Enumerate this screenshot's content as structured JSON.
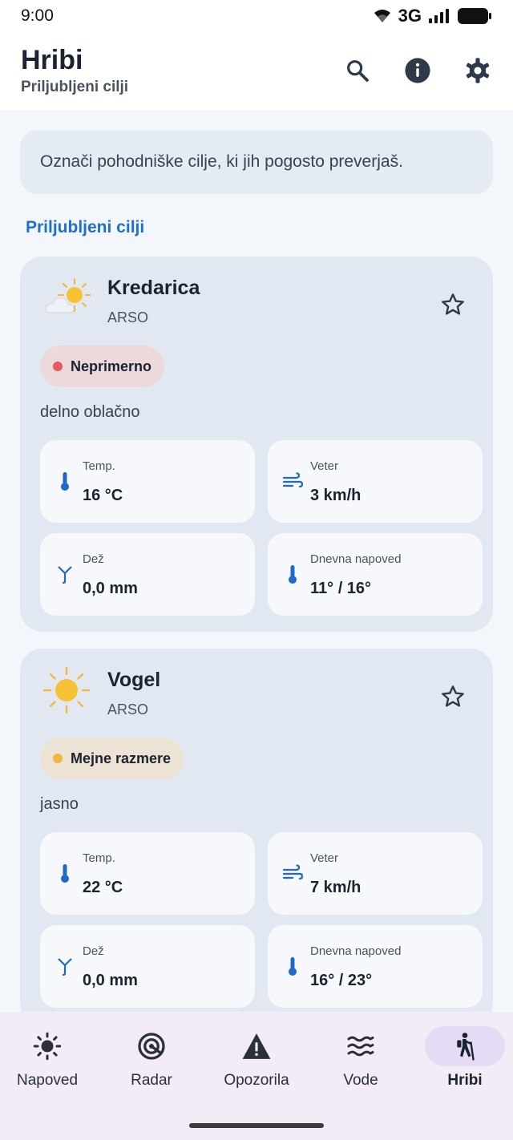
{
  "status_bar": {
    "time": "9:00",
    "network": "3G"
  },
  "header": {
    "title": "Hribi",
    "subtitle": "Priljubljeni cilji",
    "icons": [
      "search-icon",
      "info-icon",
      "gear-icon"
    ]
  },
  "info_banner": "Označi pohodniške cilje, ki jih pogosto preverjaš.",
  "section_title": "Priljubljeni cilji",
  "colors": {
    "accent": "#1f6fd0",
    "danger_dot": "#e85a5a",
    "warning_dot": "#f2b63c",
    "nav_active_bg": "#e5dbf5"
  },
  "cards": [
    {
      "name": "Kredarica",
      "source": "ARSO",
      "weather_icon": "partly-cloudy-icon",
      "status": "Neprimerno",
      "condition": "delno oblačno",
      "tiles": [
        {
          "label": "Temp.",
          "value": "16 °C",
          "icon": "thermometer-icon"
        },
        {
          "label": "Veter",
          "value": "3 km/h",
          "icon": "wind-icon"
        },
        {
          "label": "Dež",
          "value": "0,0 mm",
          "icon": "umbrella-icon"
        },
        {
          "label": "Dnevna napoved",
          "value": "11° / 16°",
          "icon": "thermometer-icon"
        }
      ]
    },
    {
      "name": "Vogel",
      "source": "ARSO",
      "weather_icon": "sun-icon",
      "status": "Mejne razmere",
      "condition": "jasno",
      "tiles": [
        {
          "label": "Temp.",
          "value": "22 °C",
          "icon": "thermometer-icon"
        },
        {
          "label": "Veter",
          "value": "7 km/h",
          "icon": "wind-icon"
        },
        {
          "label": "Dež",
          "value": "0,0 mm",
          "icon": "umbrella-icon"
        },
        {
          "label": "Dnevna napoved",
          "value": "16° / 23°",
          "icon": "thermometer-icon"
        }
      ]
    }
  ],
  "nav": [
    {
      "label": "Napoved",
      "icon": "sun-icon"
    },
    {
      "label": "Radar",
      "icon": "radar-icon"
    },
    {
      "label": "Opozorila",
      "icon": "warning-icon"
    },
    {
      "label": "Vode",
      "icon": "waves-icon"
    },
    {
      "label": "Hribi",
      "icon": "hiking-icon",
      "active": true
    }
  ]
}
